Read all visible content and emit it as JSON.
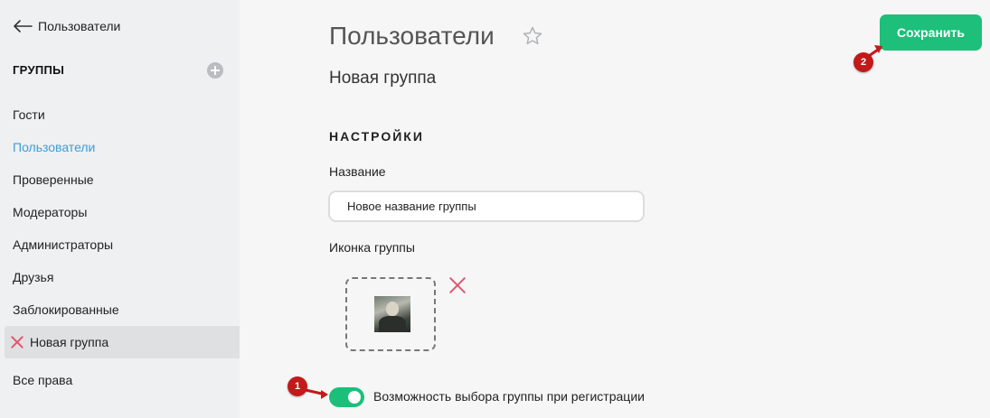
{
  "sidebar": {
    "back_label": "Пользователи",
    "section_header": "ГРУППЫ",
    "items": [
      {
        "label": "Гости"
      },
      {
        "label": "Пользователи"
      },
      {
        "label": "Проверенные"
      },
      {
        "label": "Модераторы"
      },
      {
        "label": "Администраторы"
      },
      {
        "label": "Друзья"
      },
      {
        "label": "Заблокированные"
      },
      {
        "label": "Новая группа"
      }
    ],
    "all_rights_label": "Все права"
  },
  "header": {
    "title": "Пользователи",
    "subtitle": "Новая группа",
    "save_label": "Сохранить"
  },
  "settings": {
    "section_title": "НАСТРОЙКИ",
    "name_label": "Название",
    "name_value": "Новое название группы",
    "icon_label": "Иконка группы",
    "toggle_label": "Возможность выбора группы при регистрации",
    "toggle_on": true
  },
  "markers": {
    "first": "1",
    "second": "2"
  },
  "colors": {
    "accent_green": "#1dbf7a",
    "link_blue": "#3d9fd8",
    "remove_red": "#e0566f",
    "marker_red": "#c21a1a"
  }
}
